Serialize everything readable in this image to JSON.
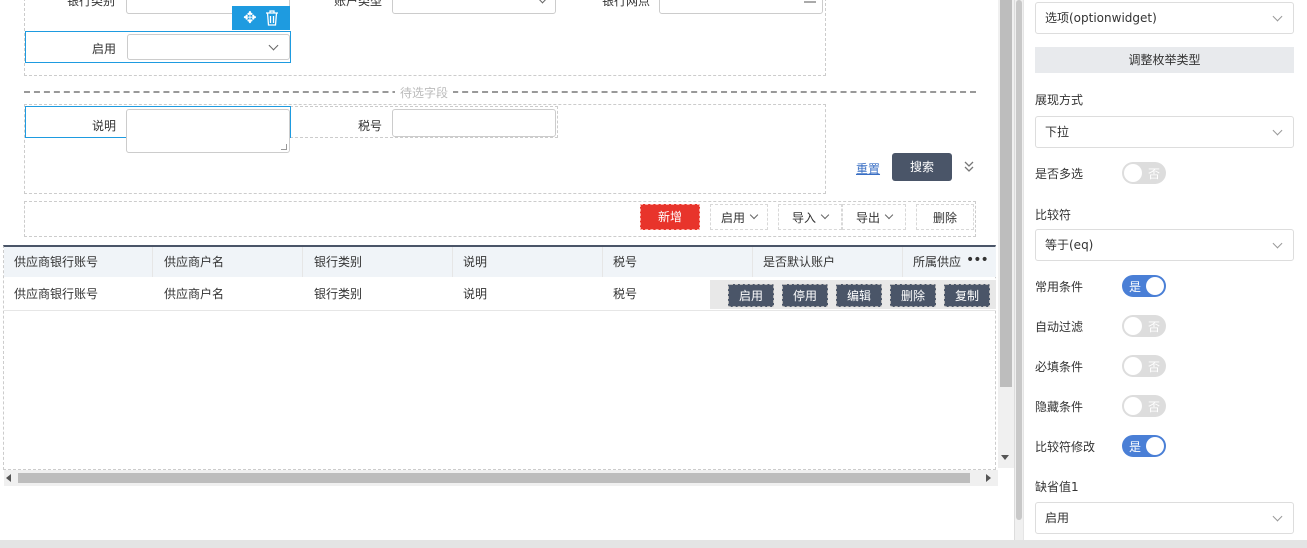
{
  "form": {
    "bank_type_label": "银行类别",
    "account_type_label": "账户类型",
    "bank_branch_label": "银行网点",
    "enabled_label": "启用",
    "pending_fields_label": "待选字段",
    "desc_label": "说明",
    "tax_label": "税号",
    "reset_label": "重置",
    "search_label": "搜索"
  },
  "toolbar": {
    "add_label": "新增",
    "enable_label": "启用",
    "import_label": "导入",
    "export_label": "导出",
    "delete_label": "删除"
  },
  "table": {
    "headers": [
      "供应商银行账号",
      "供应商户名",
      "银行类别",
      "说明",
      "税号",
      "是否默认账户",
      "所属供应"
    ],
    "row": [
      "供应商银行账号",
      "供应商户名",
      "银行类别",
      "说明",
      "税号"
    ],
    "row_actions": [
      "启用",
      "停用",
      "编辑",
      "删除",
      "复制"
    ]
  },
  "panel": {
    "widget_value": "选项(optionwidget)",
    "adjust_enum_label": "调整枚举类型",
    "display_mode_label": "展现方式",
    "display_mode_value": "下拉",
    "multi_select_label": "是否多选",
    "comparator_label": "比较符",
    "comparator_value": "等于(eq)",
    "common_cond_label": "常用条件",
    "auto_filter_label": "自动过滤",
    "required_cond_label": "必填条件",
    "hidden_cond_label": "隐藏条件",
    "comparator_edit_label": "比较符修改",
    "default_value_label": "缺省值1",
    "default_value_value": "启用",
    "yes_text": "是",
    "no_text": "否"
  },
  "colors": {
    "accent_blue": "#4a7fd6",
    "add_red": "#e8342b",
    "dark_btn": "#4a5568",
    "selection_blue": "#1e9be0"
  }
}
